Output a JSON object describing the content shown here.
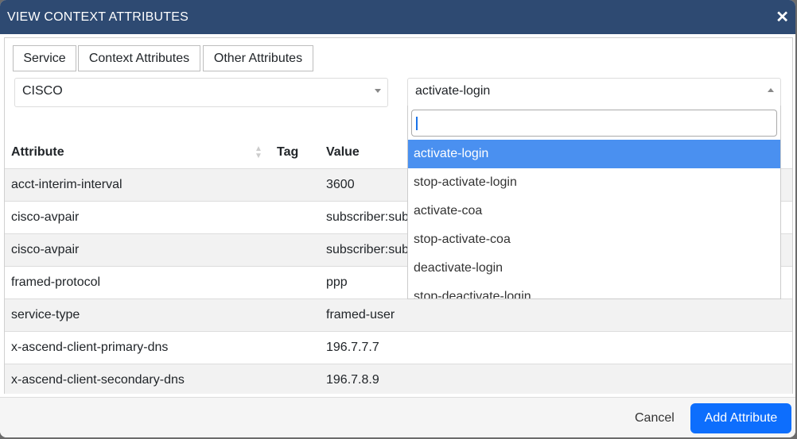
{
  "dialog": {
    "title": "VIEW CONTEXT ATTRIBUTES",
    "close_icon": "close-icon"
  },
  "tabs": [
    {
      "label": "Service"
    },
    {
      "label": "Context Attributes"
    },
    {
      "label": "Other Attributes"
    }
  ],
  "vendor_select": {
    "value": "CISCO"
  },
  "service_select": {
    "value": "activate-login",
    "search_value": "",
    "options": [
      "activate-login",
      "stop-activate-login",
      "activate-coa",
      "stop-activate-coa",
      "deactivate-login",
      "stop-deactivate-login"
    ],
    "highlighted": "activate-login"
  },
  "table": {
    "columns": [
      "Attribute",
      "Tag",
      "Value"
    ],
    "rows": [
      {
        "attribute": "acct-interim-interval",
        "tag": "",
        "value": "3600"
      },
      {
        "attribute": "cisco-avpair",
        "tag": "",
        "value": "subscriber:sub"
      },
      {
        "attribute": "cisco-avpair",
        "tag": "",
        "value": "subscriber:sub"
      },
      {
        "attribute": "framed-protocol",
        "tag": "",
        "value": "ppp"
      },
      {
        "attribute": "service-type",
        "tag": "",
        "value": "framed-user"
      },
      {
        "attribute": "x-ascend-client-primary-dns",
        "tag": "",
        "value": "196.7.7.7"
      },
      {
        "attribute": "x-ascend-client-secondary-dns",
        "tag": "",
        "value": "196.7.8.9"
      }
    ]
  },
  "footer": {
    "cancel_label": "Cancel",
    "add_label": "Add Attribute"
  },
  "colors": {
    "header": "#2e4a72",
    "primary": "#0d6efd",
    "highlight": "#4a90f0"
  }
}
